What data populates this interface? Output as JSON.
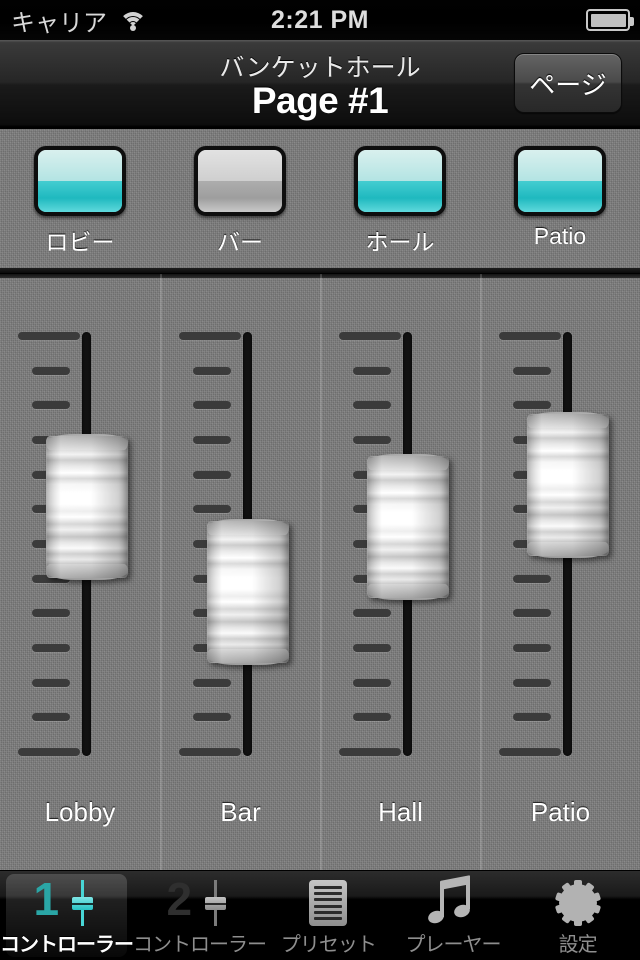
{
  "statusbar": {
    "carrier": "キャリア",
    "time": "2:21 PM",
    "wifi_icon": "wifi-icon",
    "battery_icon": "battery-full-icon"
  },
  "navbar": {
    "subtitle": "バンケットホール",
    "title": "Page #1",
    "page_button": "ページ"
  },
  "toggles": [
    {
      "label": "ロビー",
      "state": "on"
    },
    {
      "label": "バー",
      "state": "off"
    },
    {
      "label": "ホール",
      "state": "on"
    },
    {
      "label": "Patio",
      "state": "on"
    }
  ],
  "channels": [
    {
      "label": "Lobby",
      "fader_percent": 63
    },
    {
      "label": "Bar",
      "fader_percent": 33
    },
    {
      "label": "Hall",
      "fader_percent": 56
    },
    {
      "label": "Patio",
      "fader_percent": 71
    }
  ],
  "tabs": [
    {
      "label": "コントローラー",
      "icon": "fader-1-icon",
      "badge": "1",
      "active": true
    },
    {
      "label": "コントローラー",
      "icon": "fader-2-icon",
      "badge": "2",
      "active": false
    },
    {
      "label": "プリセット",
      "icon": "document-icon",
      "badge": "",
      "active": false
    },
    {
      "label": "プレーヤー",
      "icon": "music-note-icon",
      "badge": "",
      "active": false
    },
    {
      "label": "設定",
      "icon": "gear-icon",
      "badge": "",
      "active": false
    }
  ],
  "colors": {
    "accent_on": "#27c2c4",
    "accent_tab": "#48d6d6",
    "panel": "#7c7c7c",
    "track": "#111111"
  }
}
